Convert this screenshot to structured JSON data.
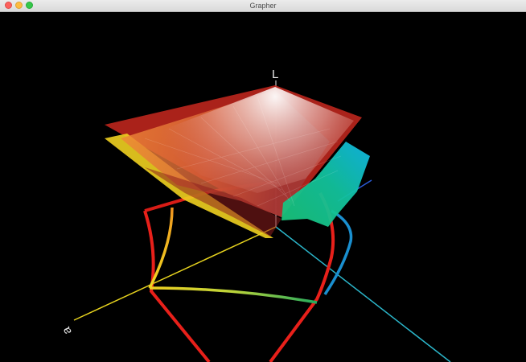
{
  "window": {
    "title": "Grapher"
  },
  "plot": {
    "axis_labels": {
      "vertical": "L",
      "left": "a"
    },
    "colors": {
      "background": "#000000",
      "outline_red": "#e8201a",
      "axis_cyan": "#2bb5c9",
      "axis_yellow": "#e6d21e",
      "axis_white": "#ffffff"
    }
  }
}
